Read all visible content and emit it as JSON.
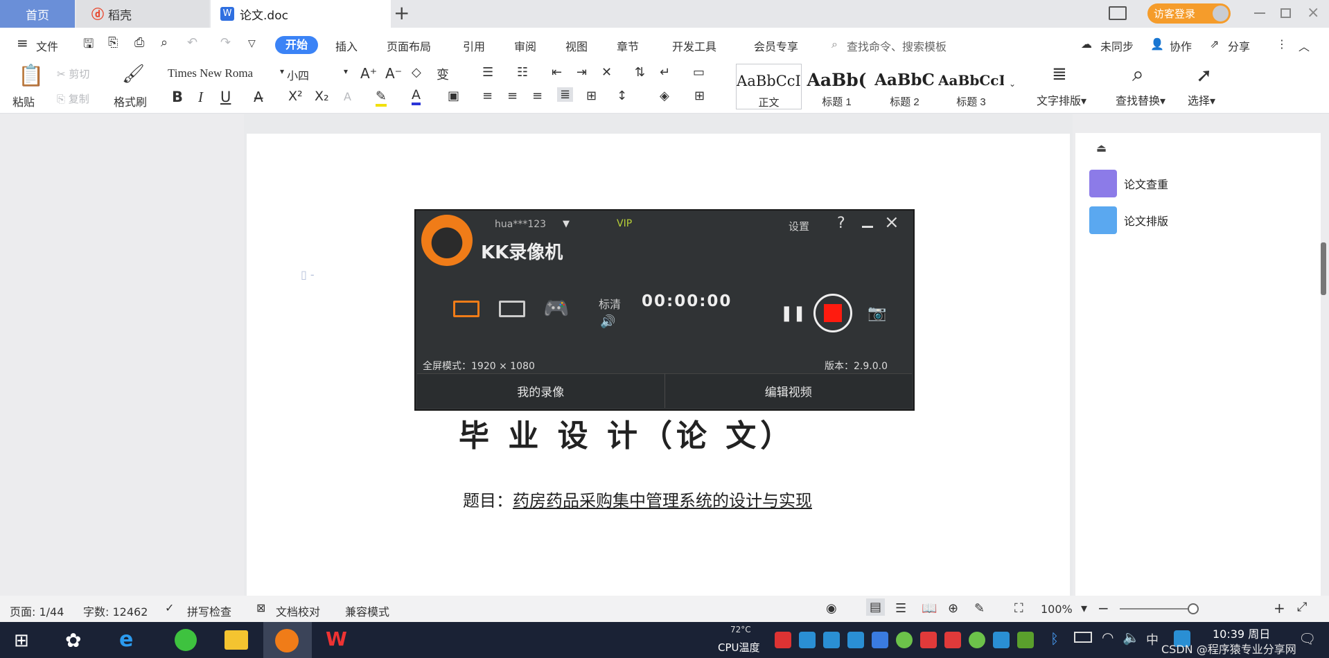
{
  "tabs": {
    "home": "首页",
    "daoke": "稻壳",
    "doc": "论文.doc",
    "add": "+"
  },
  "header": {
    "login": "访客登录"
  },
  "menu": {
    "file": "文件",
    "start": "开始",
    "insert": "插入",
    "layout": "页面布局",
    "reference": "引用",
    "review": "审阅",
    "view": "视图",
    "chapter": "章节",
    "dev": "开发工具",
    "member": "会员专享",
    "search": "查找命令、搜索模板",
    "unsynced": "未同步",
    "collab": "协作",
    "share": "分享"
  },
  "ribbon": {
    "paste": "粘贴",
    "cut": "剪切",
    "copy": "复制",
    "format_painter": "格式刷",
    "font_name": "Times New Roma",
    "font_size": "小四",
    "bold": "B",
    "italic": "I",
    "underline": "U",
    "superscript": "X²",
    "subscript": "X₂",
    "styles": [
      {
        "sample": "AaBbCcI",
        "label": "正文"
      },
      {
        "sample": "AaBb(",
        "label": "标题 1"
      },
      {
        "sample": "AaBbC",
        "label": "标题 2"
      },
      {
        "sample": "AaBbCcI",
        "label": "标题 3"
      }
    ],
    "text_layout": "文字排版",
    "find_replace": "查找替换",
    "select": "选择"
  },
  "side": {
    "check": "论文查重",
    "format": "论文排版"
  },
  "document": {
    "title": "毕 业 设 计（论 文）",
    "subject_prefix": "题目：",
    "subject": "药房药品采购集中管理系统的设计与实现"
  },
  "recorder": {
    "user": "hua***123",
    "vip": "VIP",
    "settings": "设置",
    "help": "?",
    "app_name": "KK录像机",
    "quality": "标清",
    "timer": "00:00:00",
    "mode": "全屏模式：1920 × 1080",
    "version": "版本：2.9.0.0",
    "my_videos": "我的录像",
    "edit_video": "编辑视频"
  },
  "status": {
    "page": "页面: 1/44",
    "words": "字数: 12462",
    "spell": "拼写检查",
    "proof": "文档校对",
    "compat": "兼容模式",
    "zoom": "100%"
  },
  "taskbar": {
    "temp": "72°C",
    "cpu": "CPU温度",
    "time": "10:39 周日",
    "watermark": "CSDN @程序猿专业分享网",
    "lang": "中"
  },
  "colors": {
    "accent": "#3b83f6",
    "login": "#f59c2b",
    "record": "#ff1b0f",
    "taskbar": "#1a2235"
  }
}
